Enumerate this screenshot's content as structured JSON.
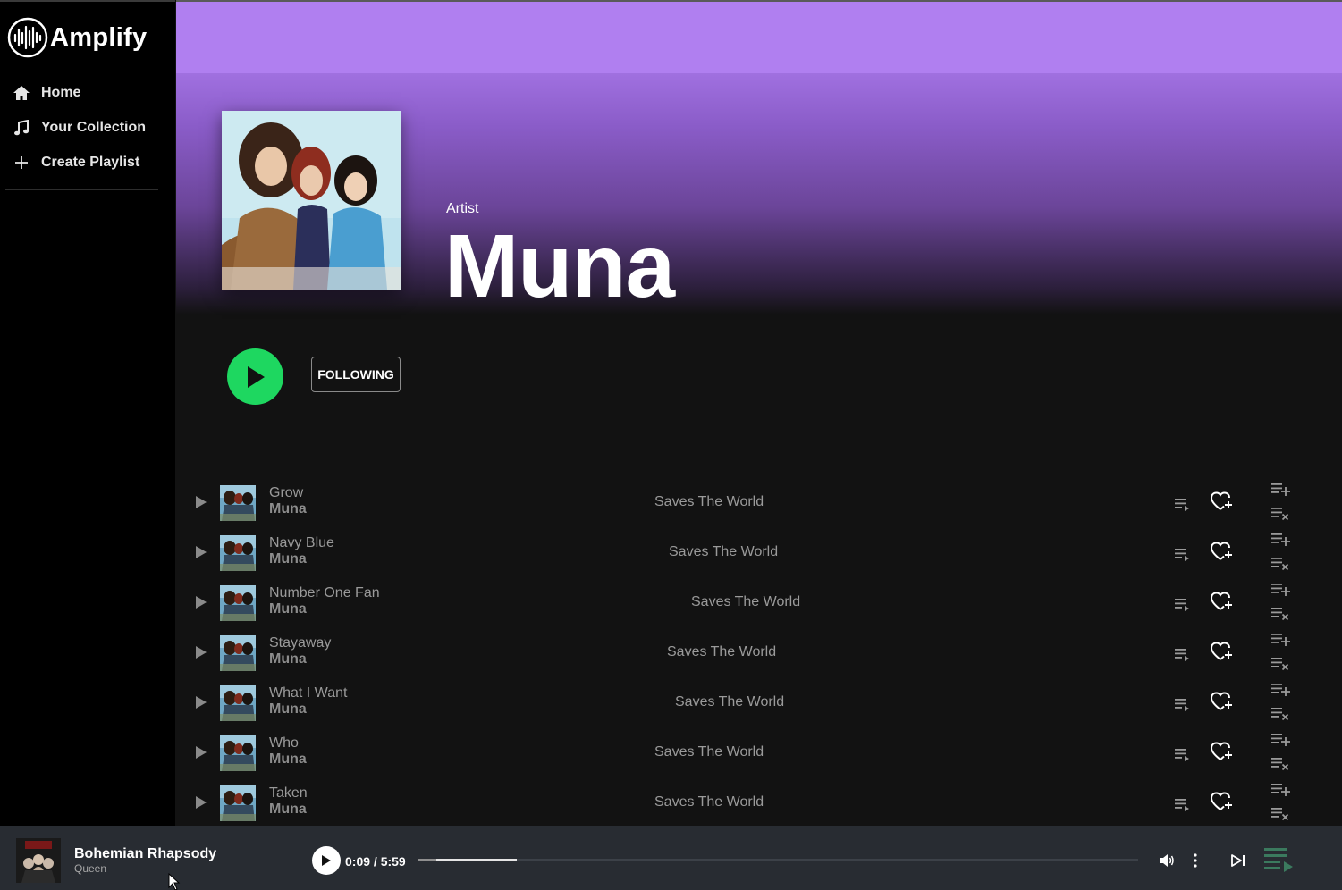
{
  "app": {
    "name": "Amplify"
  },
  "sidebar": {
    "items": [
      {
        "label": "Home",
        "icon": "home-icon"
      },
      {
        "label": "Your Collection",
        "icon": "music-note-icon"
      },
      {
        "label": "Create Playlist",
        "icon": "plus-icon"
      }
    ]
  },
  "artist": {
    "type_label": "Artist",
    "name": "Muna",
    "follow_label": "FOLLOWING"
  },
  "tracks": [
    {
      "title": "Grow",
      "artist": "Muna",
      "album": "Saves The World"
    },
    {
      "title": "Navy Blue",
      "artist": "Muna",
      "album": "Saves The World"
    },
    {
      "title": "Number One Fan",
      "artist": "Muna",
      "album": "Saves The World"
    },
    {
      "title": "Stayaway",
      "artist": "Muna",
      "album": "Saves The World"
    },
    {
      "title": "What I Want",
      "artist": "Muna",
      "album": "Saves The World"
    },
    {
      "title": "Who",
      "artist": "Muna",
      "album": "Saves The World"
    },
    {
      "title": "Taken",
      "artist": "Muna",
      "album": "Saves The World"
    }
  ],
  "player": {
    "title": "Bohemian Rhapsody",
    "artist": "Queen",
    "time": "0:09 / 5:59",
    "progress_fraction": 0.025
  },
  "colors": {
    "accent_play": "#1ed760",
    "hero_purple": "#b07ff0",
    "background": "#121212",
    "player_bg": "#282c32"
  }
}
